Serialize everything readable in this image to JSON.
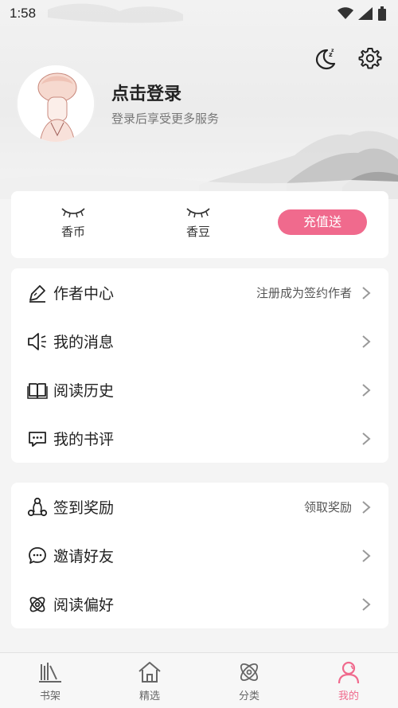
{
  "status_bar": {
    "time": "1:58"
  },
  "profile": {
    "login_title": "点击登录",
    "login_subtitle": "登录后享受更多服务"
  },
  "wallet": {
    "items": [
      {
        "label": "香币"
      },
      {
        "label": "香豆"
      }
    ],
    "recharge_label": "充值送"
  },
  "menu_group_1": [
    {
      "label": "作者中心",
      "hint": "注册成为签约作者",
      "icon": "pen-icon"
    },
    {
      "label": "我的消息",
      "hint": "",
      "icon": "speaker-icon"
    },
    {
      "label": "阅读历史",
      "hint": "",
      "icon": "book-icon"
    },
    {
      "label": "我的书评",
      "hint": "",
      "icon": "comment-icon"
    }
  ],
  "menu_group_2": [
    {
      "label": "签到奖励",
      "hint": "领取奖励",
      "icon": "network-icon"
    },
    {
      "label": "邀请好友",
      "hint": "",
      "icon": "chat-icon"
    },
    {
      "label": "阅读偏好",
      "hint": "",
      "icon": "atom-icon"
    }
  ],
  "bottom_nav": [
    {
      "label": "书架",
      "icon": "bookshelf-icon"
    },
    {
      "label": "精选",
      "icon": "home-icon"
    },
    {
      "label": "分类",
      "icon": "category-icon"
    },
    {
      "label": "我的",
      "icon": "profile-icon",
      "active": true
    }
  ],
  "colors": {
    "accent": "#f06a8d",
    "card_bg": "#ffffff",
    "page_bg": "#f4f4f4"
  }
}
